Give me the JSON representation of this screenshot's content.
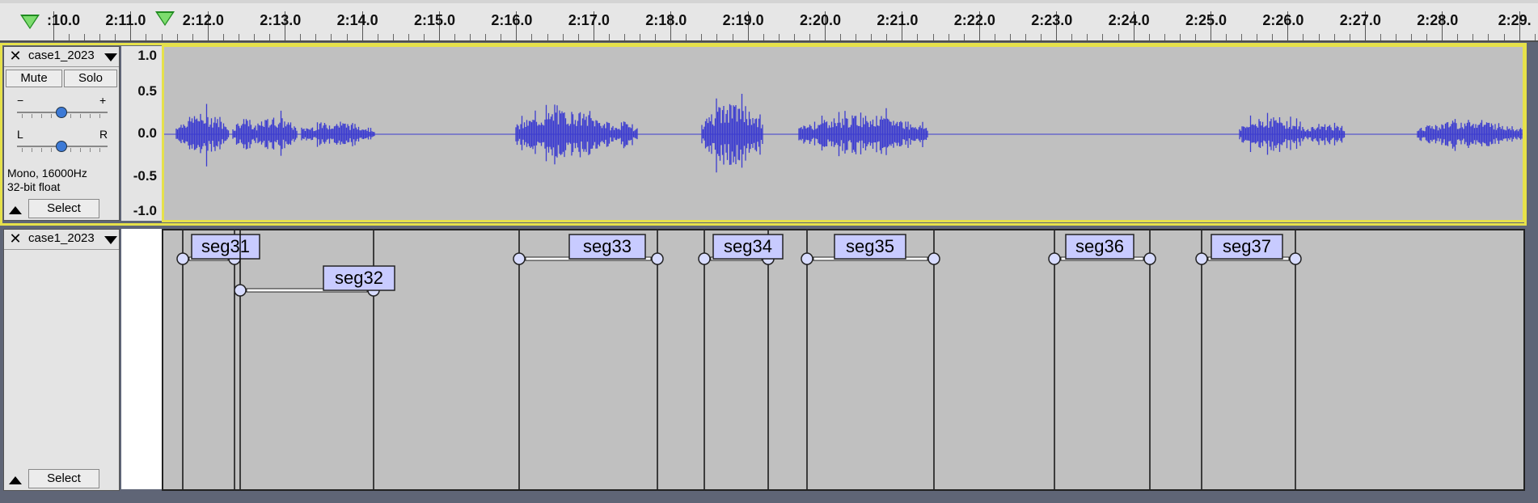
{
  "ruler": {
    "labels": [
      ":10.0",
      "2:11.0",
      "2:12.0",
      "2:13.0",
      "2:14.0",
      "2:15.0",
      "2:16.0",
      "2:17.0",
      "2:18.0",
      "2:19.0",
      "2:20.0",
      "2:21.0",
      "2:22.0",
      "2:23.0",
      "2:24.0",
      "2:25.0",
      "2:26.0",
      "2:27.0",
      "2:28.0",
      "2:29."
    ]
  },
  "audio_track": {
    "name": "case1_2023",
    "close_symbol": "✕",
    "mute_label": "Mute",
    "solo_label": "Solo",
    "gain_minus": "−",
    "gain_plus": "+",
    "pan_left": "L",
    "pan_right": "R",
    "format_line1": "Mono, 16000Hz",
    "format_line2": "32-bit float",
    "select_label": "Select",
    "scale": [
      "1.0",
      "0.5",
      "0.0",
      "-0.5",
      "-1.0"
    ],
    "wave_color": "#3b3bd0"
  },
  "label_track": {
    "name": "case1_2023",
    "close_symbol": "✕",
    "select_label": "Select",
    "labels": [
      {
        "text": "seg31",
        "start": "2:11.6",
        "end": "2:12.4"
      },
      {
        "text": "seg32",
        "start": "2:12.5",
        "end": "2:14.6"
      },
      {
        "text": "seg33",
        "start": "2:16.9",
        "end": "2:19.0"
      },
      {
        "text": "seg34",
        "start": "2:19.6",
        "end": "2:20.6"
      },
      {
        "text": "seg35",
        "start": "2:21.2",
        "end": "2:23.2"
      },
      {
        "text": "seg36",
        "start": "2:25.1",
        "end": "2:26.6"
      },
      {
        "text": "seg37",
        "start": "2:27.4",
        "end": "2:29.0"
      }
    ]
  }
}
